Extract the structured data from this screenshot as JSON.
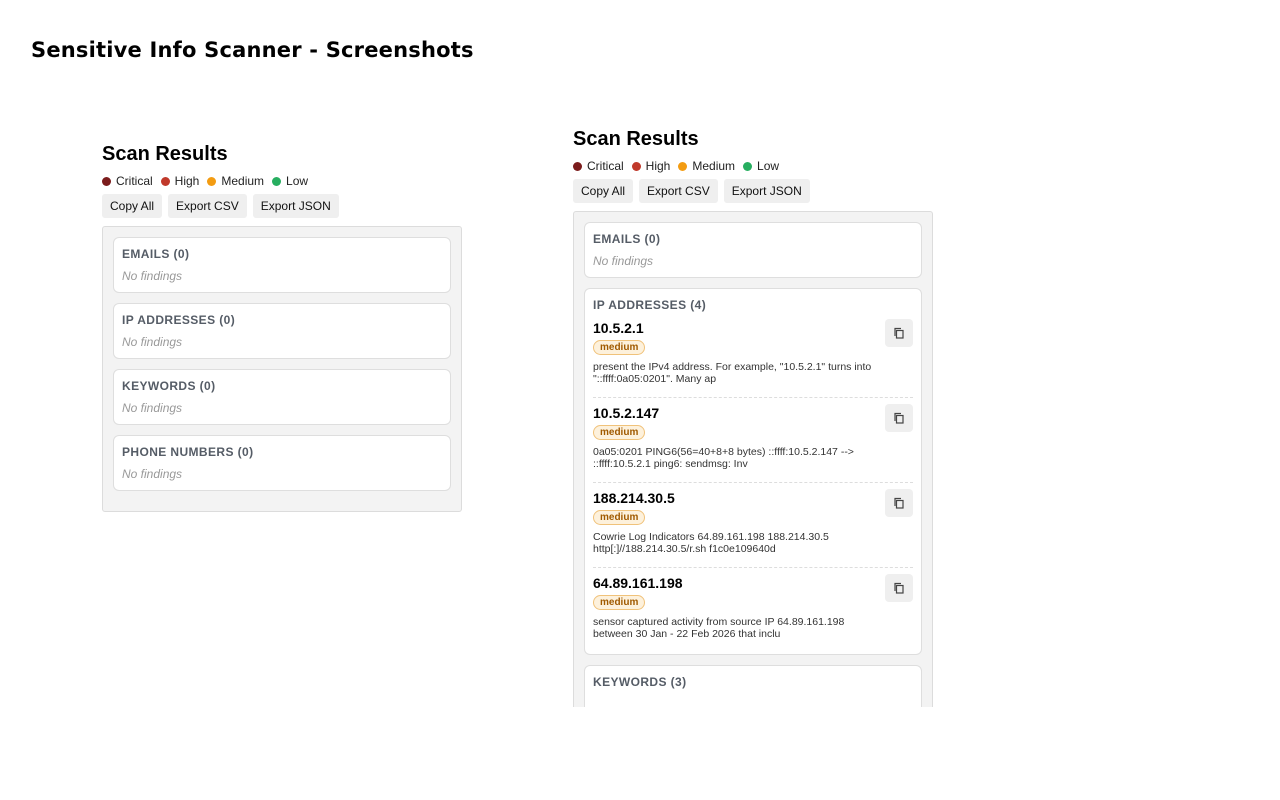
{
  "page": {
    "title": "Sensitive Info Scanner - Screenshots"
  },
  "legend": {
    "critical": "Critical",
    "high": "High",
    "medium": "Medium",
    "low": "Low",
    "colors": {
      "critical": "#7b1c1c",
      "high": "#c0392b",
      "medium": "#f39c12",
      "low": "#27ae60"
    }
  },
  "actions": {
    "copy_all": "Copy All",
    "export_csv": "Export CSV",
    "export_json": "Export JSON"
  },
  "left": {
    "title": "Scan Results",
    "sections": [
      {
        "title": "EMAILS (0)",
        "empty": "No findings"
      },
      {
        "title": "IP ADDRESSES (0)",
        "empty": "No findings"
      },
      {
        "title": "KEYWORDS (0)",
        "empty": "No findings"
      },
      {
        "title": "PHONE NUMBERS (0)",
        "empty": "No findings"
      }
    ]
  },
  "right": {
    "title": "Scan Results",
    "emails": {
      "title": "EMAILS (0)",
      "empty": "No findings"
    },
    "ip_addresses": {
      "title": "IP ADDRESSES (4)",
      "findings": [
        {
          "value": "10.5.2.1",
          "severity": "medium",
          "context": " present the IPv4 address. For example, \"10.5.2.1\" turns into \"::ffff:0a05:0201\". Many ap"
        },
        {
          "value": "10.5.2.147",
          "severity": "medium",
          "context": " 0a05:0201 PING6(56=40+8+8 bytes) ::ffff:10.5.2.147 --> ::ffff:10.5.2.1 ping6: sendmsg: Inv"
        },
        {
          "value": "188.214.30.5",
          "severity": "medium",
          "context": " Cowrie Log Indicators 64.89.161.198 188.214.30.5 http[:]//188.214.30.5/r.sh f1c0e109640d"
        },
        {
          "value": "64.89.161.198",
          "severity": "medium",
          "context": " sensor captured activity from source IP 64.89.161.198 between 30 Jan - 22 Feb 2026 that inclu"
        }
      ]
    },
    "keywords": {
      "title": "KEYWORDS (3)"
    }
  }
}
